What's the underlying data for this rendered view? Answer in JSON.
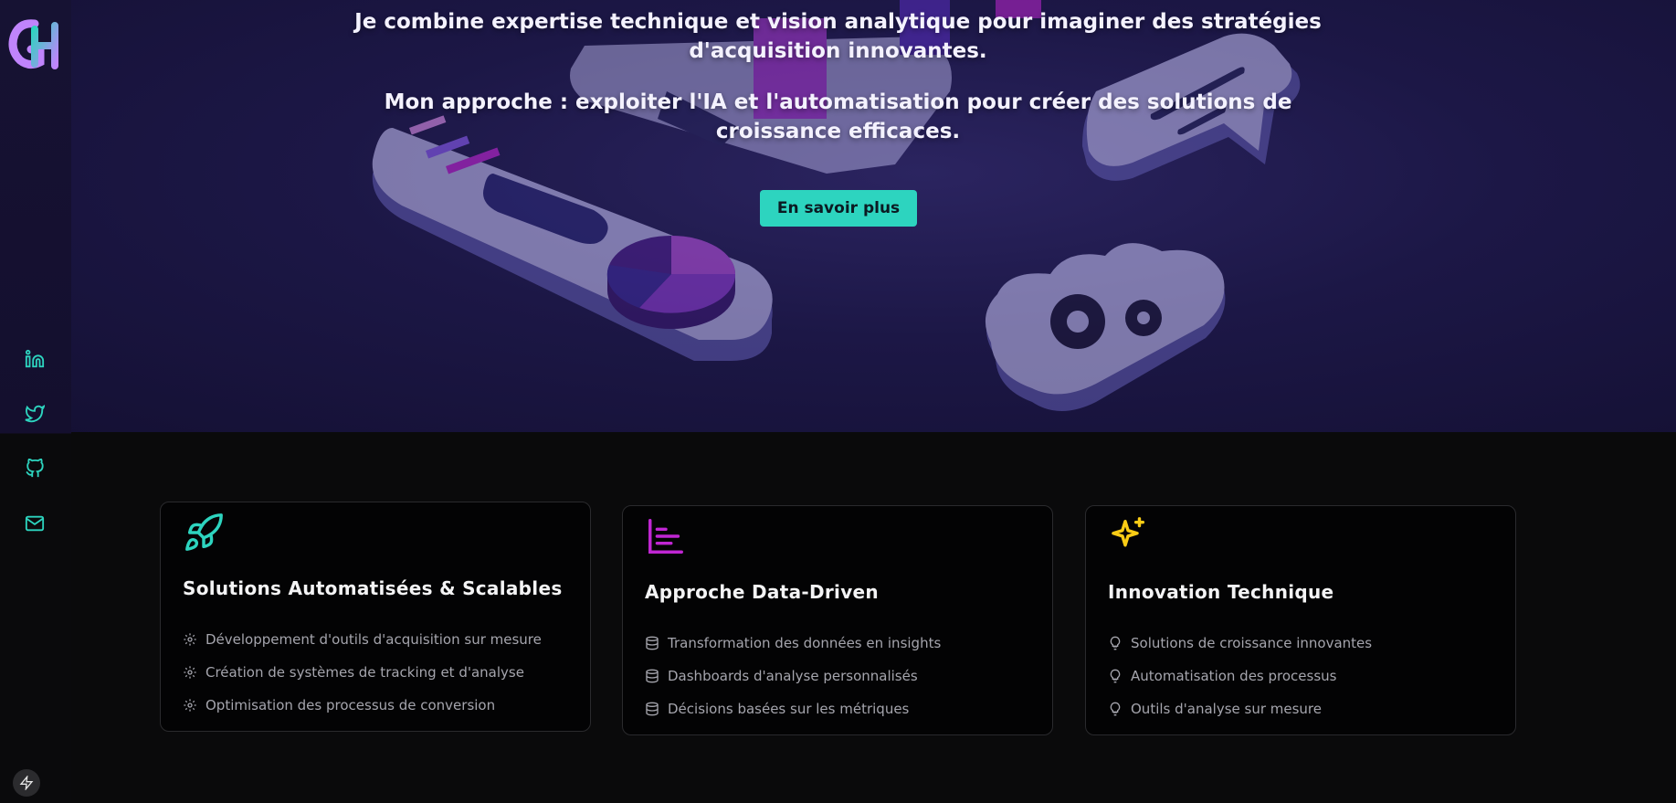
{
  "hero": {
    "intro_line1": "Je combine expertise technique et vision analytique pour imaginer des stratégies",
    "intro_line2": "d'acquisition innovantes.",
    "approach_line1": "Mon approche : exploiter l'IA et l'automatisation pour créer des solutions de",
    "approach_line2": "croissance efficaces.",
    "cta_label": "En savoir plus",
    "accent_color": "#2dd4bf"
  },
  "sidebar": {
    "logo_text": "GH",
    "social": [
      {
        "name": "linkedin-icon"
      },
      {
        "name": "twitter-icon"
      },
      {
        "name": "github-icon"
      },
      {
        "name": "mail-icon"
      }
    ]
  },
  "cards": [
    {
      "icon": "rocket-icon",
      "icon_color": "#2dd4bf",
      "title": "Solutions Automatisées & Scalables",
      "bullet_icon": "gear-icon",
      "items": [
        "Développement d'outils d'acquisition sur mesure",
        "Création de systèmes de tracking et d'analyse",
        "Optimisation des processus de conversion"
      ]
    },
    {
      "icon": "bar-chart-icon",
      "icon_color": "#c026d3",
      "title": "Approche Data-Driven",
      "bullet_icon": "database-icon",
      "items": [
        "Transformation des données en insights",
        "Dashboards d'analyse personnalisés",
        "Décisions basées sur les métriques"
      ]
    },
    {
      "icon": "sparkles-icon",
      "icon_color": "#facc15",
      "title": "Innovation Technique",
      "bullet_icon": "lightbulb-icon",
      "items": [
        "Solutions de croissance innovantes",
        "Automatisation des processus",
        "Outils d'analyse sur mesure"
      ]
    }
  ]
}
